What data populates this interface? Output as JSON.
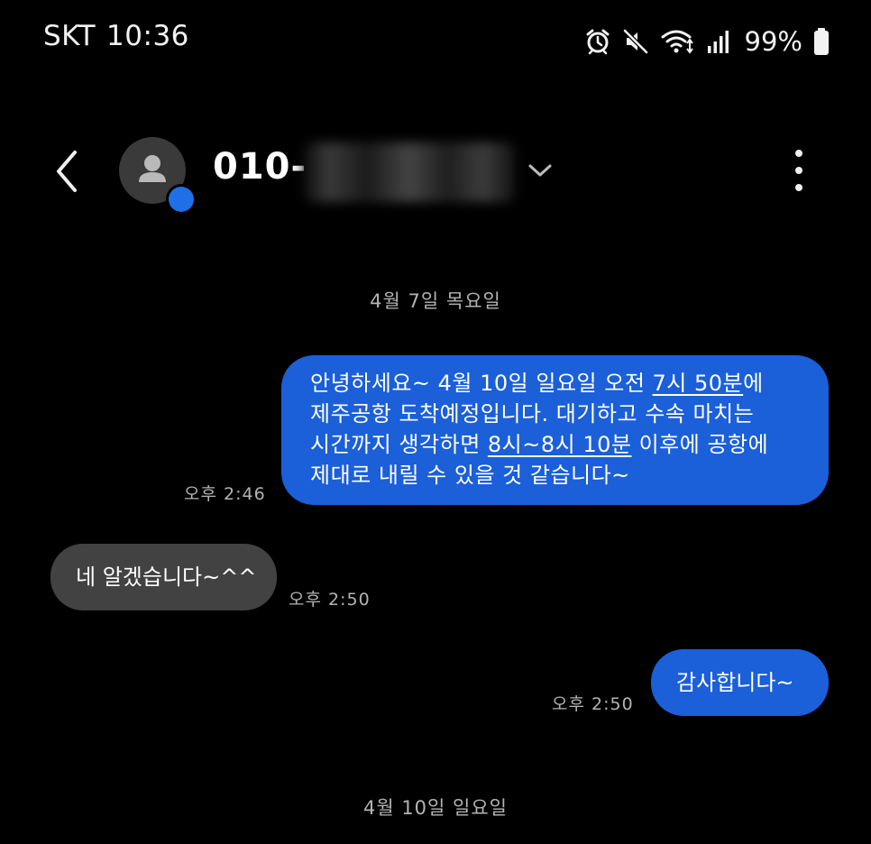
{
  "status_bar": {
    "carrier": "SKT",
    "time": "10:36",
    "battery": "99%",
    "icons": [
      "alarm-icon",
      "mute-icon",
      "wifi-icon",
      "signal-icon",
      "battery-icon"
    ]
  },
  "header": {
    "contact": "010-",
    "redacted": true,
    "icons": [
      "back-icon",
      "avatar-person-icon",
      "chevron-down-icon",
      "more-vert-icon"
    ]
  },
  "dates": [
    {
      "label": "4월 7일 목요일"
    },
    {
      "label": "4월 10일 일요일"
    }
  ],
  "messages": [
    {
      "direction": "outgoing",
      "time": "오후 2:46",
      "lines": [
        {
          "a": "안녕하세요~ 4월 10일 일요일 오전 ",
          "u": "7시 50분",
          "b": "에"
        },
        {
          "a": "제주공항 도착예정입니다. 대기하고 수속 마치는",
          "u": "",
          "b": ""
        },
        {
          "a": "시간까지 생각하면 ",
          "u": "8시~8시 10분",
          "b": " 이후에 공항에"
        },
        {
          "a": "제대로 내릴 수 있을 것 같습니다~",
          "u": "",
          "b": ""
        }
      ]
    },
    {
      "direction": "incoming",
      "time": "오후 2:50",
      "text": "네 알겠습니다~^^"
    },
    {
      "direction": "outgoing",
      "time": "오후 2:50",
      "text": "감사합니다~"
    }
  ],
  "colors": {
    "background": "#000000",
    "outgoing_bubble": "#1b5fd9",
    "incoming_bubble": "#424242",
    "meta_text": "#b4b4b4"
  }
}
